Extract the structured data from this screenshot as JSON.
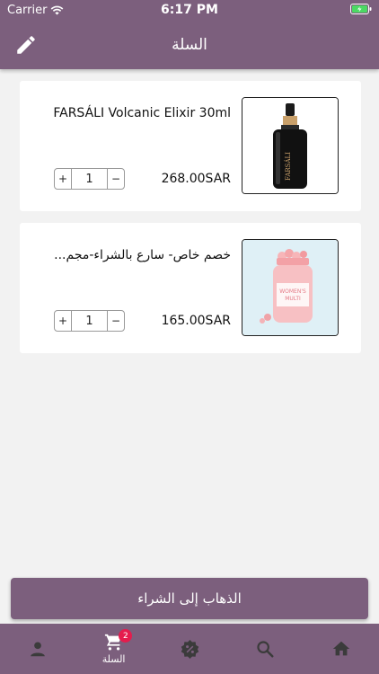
{
  "status_bar": {
    "carrier": "Carrier",
    "time": "6:17 PM"
  },
  "header": {
    "title": "السلة",
    "edit_icon": "pencil-icon"
  },
  "cart": {
    "items": [
      {
        "name": "FARSÁLI  Volcanic Elixir 30ml",
        "price": "268.00SAR",
        "quantity": "1",
        "image": "serum-bottle"
      },
      {
        "name": "خصم خاص- سارع بالشراء-مجم...",
        "price": "165.00SAR",
        "quantity": "1",
        "image": "vitamin-jar"
      }
    ]
  },
  "checkout": {
    "label": "الذهاب إلى الشراء"
  },
  "tabbar": {
    "tabs": [
      {
        "icon": "profile-icon",
        "label": ""
      },
      {
        "icon": "cart-icon",
        "label": "السلة",
        "badge": "2",
        "active": true
      },
      {
        "icon": "offers-icon",
        "label": ""
      },
      {
        "icon": "search-icon",
        "label": ""
      },
      {
        "icon": "home-icon",
        "label": ""
      }
    ]
  },
  "colors": {
    "primary": "#7c5f7d",
    "badge": "#e51c4d",
    "background": "#f2f2f2"
  }
}
